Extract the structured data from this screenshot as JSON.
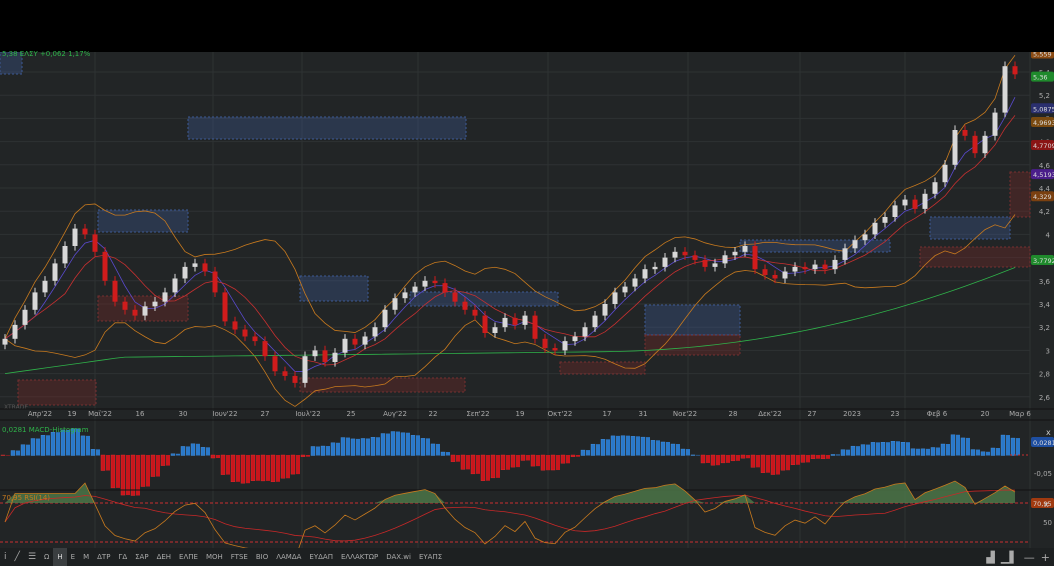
{
  "legend": {
    "symbol_line": "5,38 ΕΛΣΥ +0,062 1,17%",
    "watermark": "XTRADE"
  },
  "price_axis": {
    "ticks": [
      "5,4",
      "5,2",
      "5",
      "4,8",
      "4,6",
      "4,4",
      "4,2",
      "4",
      "3,8",
      "3,6",
      "3,4",
      "3,2",
      "3",
      "2,8",
      "2,6"
    ],
    "badges": [
      {
        "text": "5,559",
        "color": "#8a4a12"
      },
      {
        "text": "5,36",
        "color": "#1f8a2c"
      },
      {
        "text": "5,0875",
        "color": "#2a2f6e"
      },
      {
        "text": "4,9693",
        "color": "#7a4a10"
      },
      {
        "text": "4,7709",
        "color": "#8a1414"
      },
      {
        "text": "4,5193",
        "color": "#4a1e8a"
      },
      {
        "text": "4,329",
        "color": "#7a4010"
      },
      {
        "text": "3,7792",
        "color": "#1f8a2c"
      }
    ]
  },
  "time_axis": [
    "Απρ'22",
    "19",
    "Μαϊ'22",
    "16",
    "30",
    "Ιουν'22",
    "27",
    "Ιουλ'22",
    "25",
    "Αυγ'22",
    "22",
    "Σεπ'22",
    "19",
    "Οκτ'22",
    "17",
    "31",
    "Νοε'22",
    "28",
    "Δεκ'22",
    "27",
    "2023",
    "23",
    "Φεβ 6",
    "20",
    "Μαρ 6"
  ],
  "macd": {
    "label": "0,0281 MACD-Histogram",
    "value": "0,0281",
    "tick": "-0,05",
    "close": "x"
  },
  "rsi": {
    "label": "70,95 RSI(14)",
    "value": "70,95",
    "tick": "50",
    "close": "x"
  },
  "colors": {
    "up": "#d8d8d8",
    "down": "#d01c1c",
    "macd_up": "#2a78c8",
    "macd_down": "#c8161c",
    "ma_long": "#2fb34a",
    "bands": "#c87a1e"
  },
  "chart_data": {
    "type": "candlestick",
    "title": "ΕΛΣΥ",
    "ylim": [
      2.5,
      5.6
    ],
    "closes": [
      3.1,
      3.22,
      3.35,
      3.5,
      3.6,
      3.75,
      3.9,
      4.05,
      4.0,
      3.85,
      3.6,
      3.42,
      3.35,
      3.3,
      3.38,
      3.42,
      3.5,
      3.62,
      3.72,
      3.75,
      3.68,
      3.5,
      3.25,
      3.18,
      3.12,
      3.08,
      2.95,
      2.82,
      2.78,
      2.72,
      2.95,
      3.0,
      2.9,
      2.98,
      3.1,
      3.05,
      3.12,
      3.2,
      3.35,
      3.45,
      3.5,
      3.55,
      3.6,
      3.58,
      3.5,
      3.42,
      3.35,
      3.3,
      3.15,
      3.2,
      3.28,
      3.22,
      3.3,
      3.1,
      3.02,
      3.0,
      3.08,
      3.12,
      3.2,
      3.3,
      3.4,
      3.5,
      3.55,
      3.62,
      3.7,
      3.72,
      3.8,
      3.85,
      3.82,
      3.78,
      3.72,
      3.75,
      3.82,
      3.85,
      3.9,
      3.7,
      3.65,
      3.62,
      3.68,
      3.72,
      3.7,
      3.74,
      3.7,
      3.78,
      3.88,
      3.95,
      4.0,
      4.1,
      4.15,
      4.25,
      4.3,
      4.22,
      4.35,
      4.45,
      4.6,
      4.9,
      4.85,
      4.7,
      4.85,
      5.05,
      5.45,
      5.38
    ]
  },
  "toolbar": {
    "items": [
      "i",
      "╱",
      "☰",
      "Ω",
      "Η",
      "Ε",
      "Μ",
      "ΔΤΡ",
      "ΓΔ",
      "ΣΑΡ",
      "ΔΕΗ",
      "ΕΛΠΕ",
      "ΜΟΗ",
      "FTSE",
      "ΒΙΟ",
      "ΛΑΜΔΑ",
      "ΕΥΔΑΠ",
      "ΕΛΛΑΚΤΩΡ",
      "DAX.wi",
      "ΕΥΑΠΣ"
    ],
    "active": "Η",
    "right": [
      "▟",
      "▁▌",
      "—",
      "+"
    ]
  }
}
